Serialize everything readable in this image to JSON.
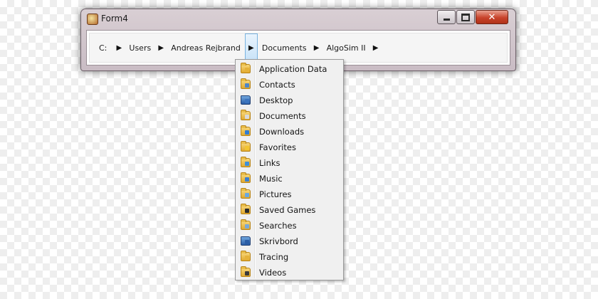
{
  "window": {
    "title": "Form4"
  },
  "breadcrumb": {
    "items": [
      "C:",
      "Users",
      "Andreas Rejbrand",
      "Documents",
      "AlgoSim II"
    ],
    "separator": "▶"
  },
  "menu": {
    "items": [
      {
        "label": "Application Data",
        "icon": "folder-icon",
        "accent": "#e5b23a"
      },
      {
        "label": "Contacts",
        "icon": "contacts-folder-icon",
        "accent": "#4f86c6"
      },
      {
        "label": "Desktop",
        "icon": "desktop-folder-icon",
        "accent": "#3b74bf"
      },
      {
        "label": "Documents",
        "icon": "documents-folder-icon",
        "accent": "#d9d9d9"
      },
      {
        "label": "Downloads",
        "icon": "downloads-folder-icon",
        "accent": "#2f7cd3"
      },
      {
        "label": "Favorites",
        "icon": "favorites-folder-icon",
        "accent": "#f2c531"
      },
      {
        "label": "Links",
        "icon": "links-folder-icon",
        "accent": "#3f8fd9"
      },
      {
        "label": "Music",
        "icon": "music-folder-icon",
        "accent": "#3c7fcf"
      },
      {
        "label": "Pictures",
        "icon": "pictures-folder-icon",
        "accent": "#6aa8e0"
      },
      {
        "label": "Saved Games",
        "icon": "saved-games-folder-icon",
        "accent": "#2b2b2b"
      },
      {
        "label": "Searches",
        "icon": "searches-folder-icon",
        "accent": "#7aa9d6"
      },
      {
        "label": "Skrivbord",
        "icon": "skrivbord-folder-icon",
        "accent": "#2a5da6"
      },
      {
        "label": "Tracing",
        "icon": "folder-icon",
        "accent": "#e5b23a"
      },
      {
        "label": "Videos",
        "icon": "videos-folder-icon",
        "accent": "#3a3a3a"
      }
    ]
  }
}
